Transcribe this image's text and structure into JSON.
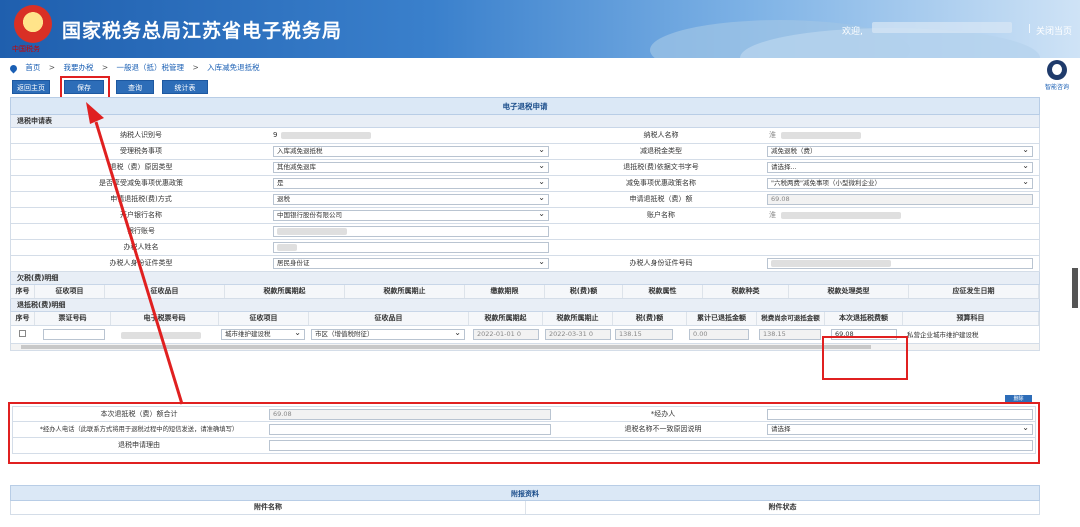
{
  "header": {
    "logo_sub": "中国税务",
    "title": "国家税务总局江苏省电子税务局",
    "welcome": "欢迎,",
    "separator": "|",
    "close_link": "关闭当页"
  },
  "breadcrumb": [
    "首页",
    "我要办税",
    "一般退（抵）税管理",
    "入库减免退抵税"
  ],
  "breadcrumb_sep": ">",
  "toolbar": {
    "home": "返回主页",
    "save": "保存",
    "query": "查询",
    "stats": "统计表"
  },
  "assistant": {
    "label": "智能咨询"
  },
  "form_title": "电子退税申请",
  "section_apply": "退税申请表",
  "fields": {
    "taxpayer_id_label": "纳税人识别号",
    "taxpayer_id_value": "9",
    "taxpayer_name_label": "纳税人名称",
    "taxpayer_name_value": "淮",
    "handle_item_label": "受理税务事项",
    "handle_item_value": "入库减免退抵税",
    "reduce_type_label": "减退税金类型",
    "reduce_type_value": "减免退税（费）",
    "refund_reason_label": "退税（费）原因类型",
    "refund_reason_value": "其他减免退库",
    "refund_doc_label": "退抵税(费)依据文书字号",
    "refund_doc_value": "请选择...",
    "policy_flag_label": "是否享受减免事项优惠政策",
    "policy_flag_value": "是",
    "policy_name_label": "减免事项优惠政策名称",
    "policy_name_value": "\"六税两费\"减免事项（小型微利企业）",
    "method_label": "申请退抵税(费)方式",
    "method_value": "退税",
    "apply_amount_label": "申请退抵税（费）额",
    "apply_amount_value": "69.08",
    "bank_label": "开户银行名称",
    "bank_value": "中国银行股份有限公司",
    "account_name_label": "账户名称",
    "account_name_value": "淮",
    "account_no_label": "银行账号",
    "handler_name_label": "办税人姓名",
    "id_type_label": "办税人身份证件类型",
    "id_type_value": "居民身份证",
    "id_no_label": "办税人身份证件号码"
  },
  "section_owe": "欠税(费)明细",
  "owe_headers": [
    "序号",
    "征收项目",
    "征收品目",
    "税款所属期起",
    "税款所属期止",
    "缴款期限",
    "税(费)额",
    "税款属性",
    "税款种类",
    "税款处理类型",
    "应征发生日期"
  ],
  "section_refund": "退抵税(费)明细",
  "refund_headers": [
    "序号",
    "票证号码",
    "电子税票号码",
    "征收项目",
    "征收品目",
    "税款所属期起",
    "税款所属期止",
    "税(费)额",
    "累计已退抵金额",
    "税费尚余可退抵金额",
    "本次退抵税费额",
    "预算科目"
  ],
  "refund_row": {
    "levy_item": "城市维护建设税",
    "levy_sub": "市区（增值税附征）",
    "period_start": "2022-01-01 0",
    "period_end": "2022-03-31 0",
    "tax_amount": "138.15",
    "refunded": "0.00",
    "remaining": "138.15",
    "this_refund": "69.08",
    "budget": "私营企业城市维护建设税"
  },
  "mini_button": "删除",
  "summary": {
    "total_label": "本次退抵税（费）额合计",
    "total_value": "69.08",
    "handler_label": "*经办人",
    "phone_label": "*经办人电话（此联系方式将用于退税过程中的短信发送，请准确填写）",
    "mismatch_label": "退税名称不一致原因说明",
    "mismatch_value": "请选择",
    "reason_label": "退税申请理由"
  },
  "attach": {
    "title": "附报资料",
    "col1": "附件名称",
    "col2": "附件状态"
  },
  "colors": {
    "accent": "#2d6db8",
    "highlight": "#e02020"
  }
}
